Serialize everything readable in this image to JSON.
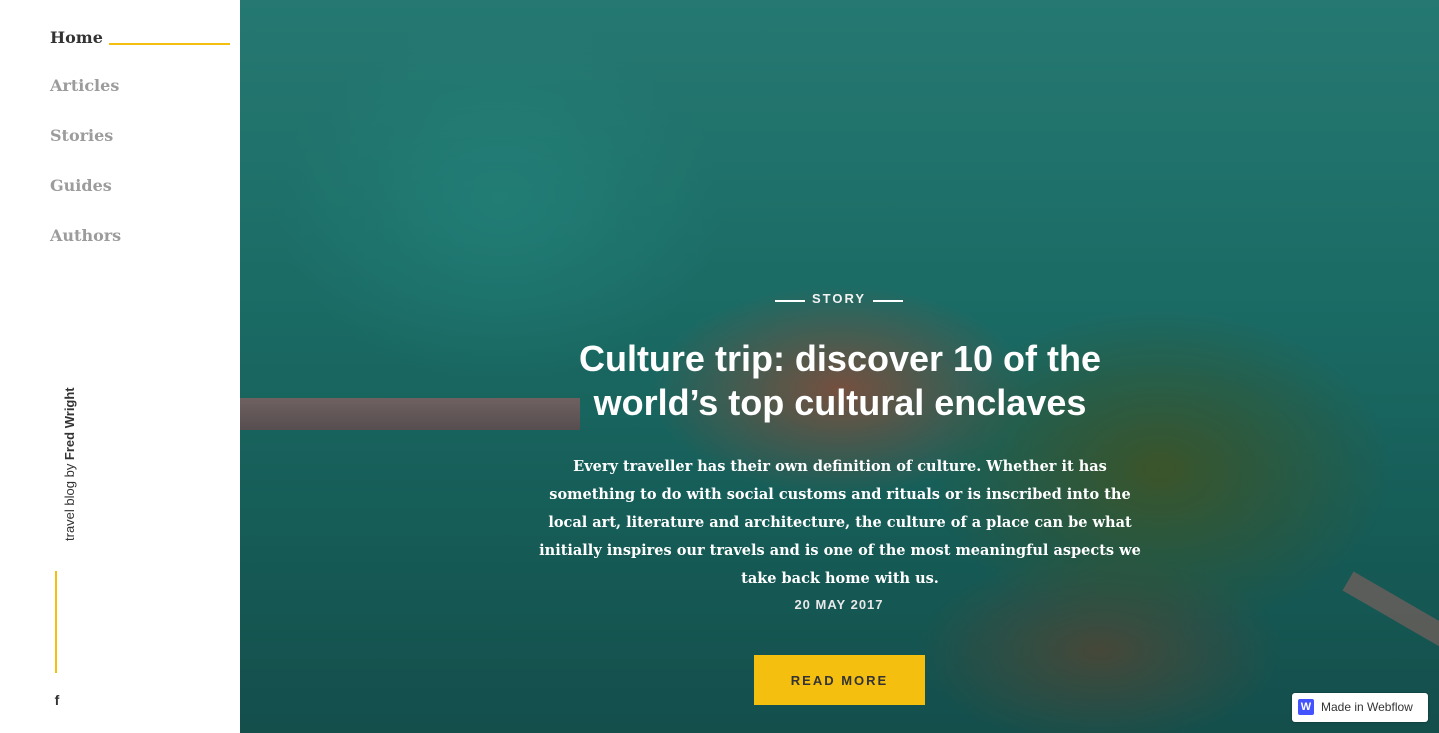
{
  "sidebar": {
    "nav": [
      {
        "label": "Home",
        "active": true
      },
      {
        "label": "Articles",
        "active": false
      },
      {
        "label": "Stories",
        "active": false
      },
      {
        "label": "Guides",
        "active": false
      },
      {
        "label": "Authors",
        "active": false
      }
    ],
    "brand_prefix": "travel blog by ",
    "brand_name": "Fred Wright",
    "social_icon": "f"
  },
  "hero": {
    "category": "STORY",
    "title": "Culture trip: discover 10 of the world’s top cultural enclaves",
    "description": "Every traveller has their own definition of culture. Whether it has something to do with social customs and rituals or is inscribed into the local art, literature and architecture, the culture of a place can be what initially inspires our travels and is one of the most meaningful aspects we take back home with us.",
    "date": "20 MAY 2017",
    "cta_label": "READ MORE"
  },
  "badge": {
    "icon": "W",
    "label": "Made in Webflow"
  },
  "colors": {
    "accent": "#f5bf0f",
    "active_nav": "#333333",
    "inactive_nav": "#9c9c9c"
  }
}
